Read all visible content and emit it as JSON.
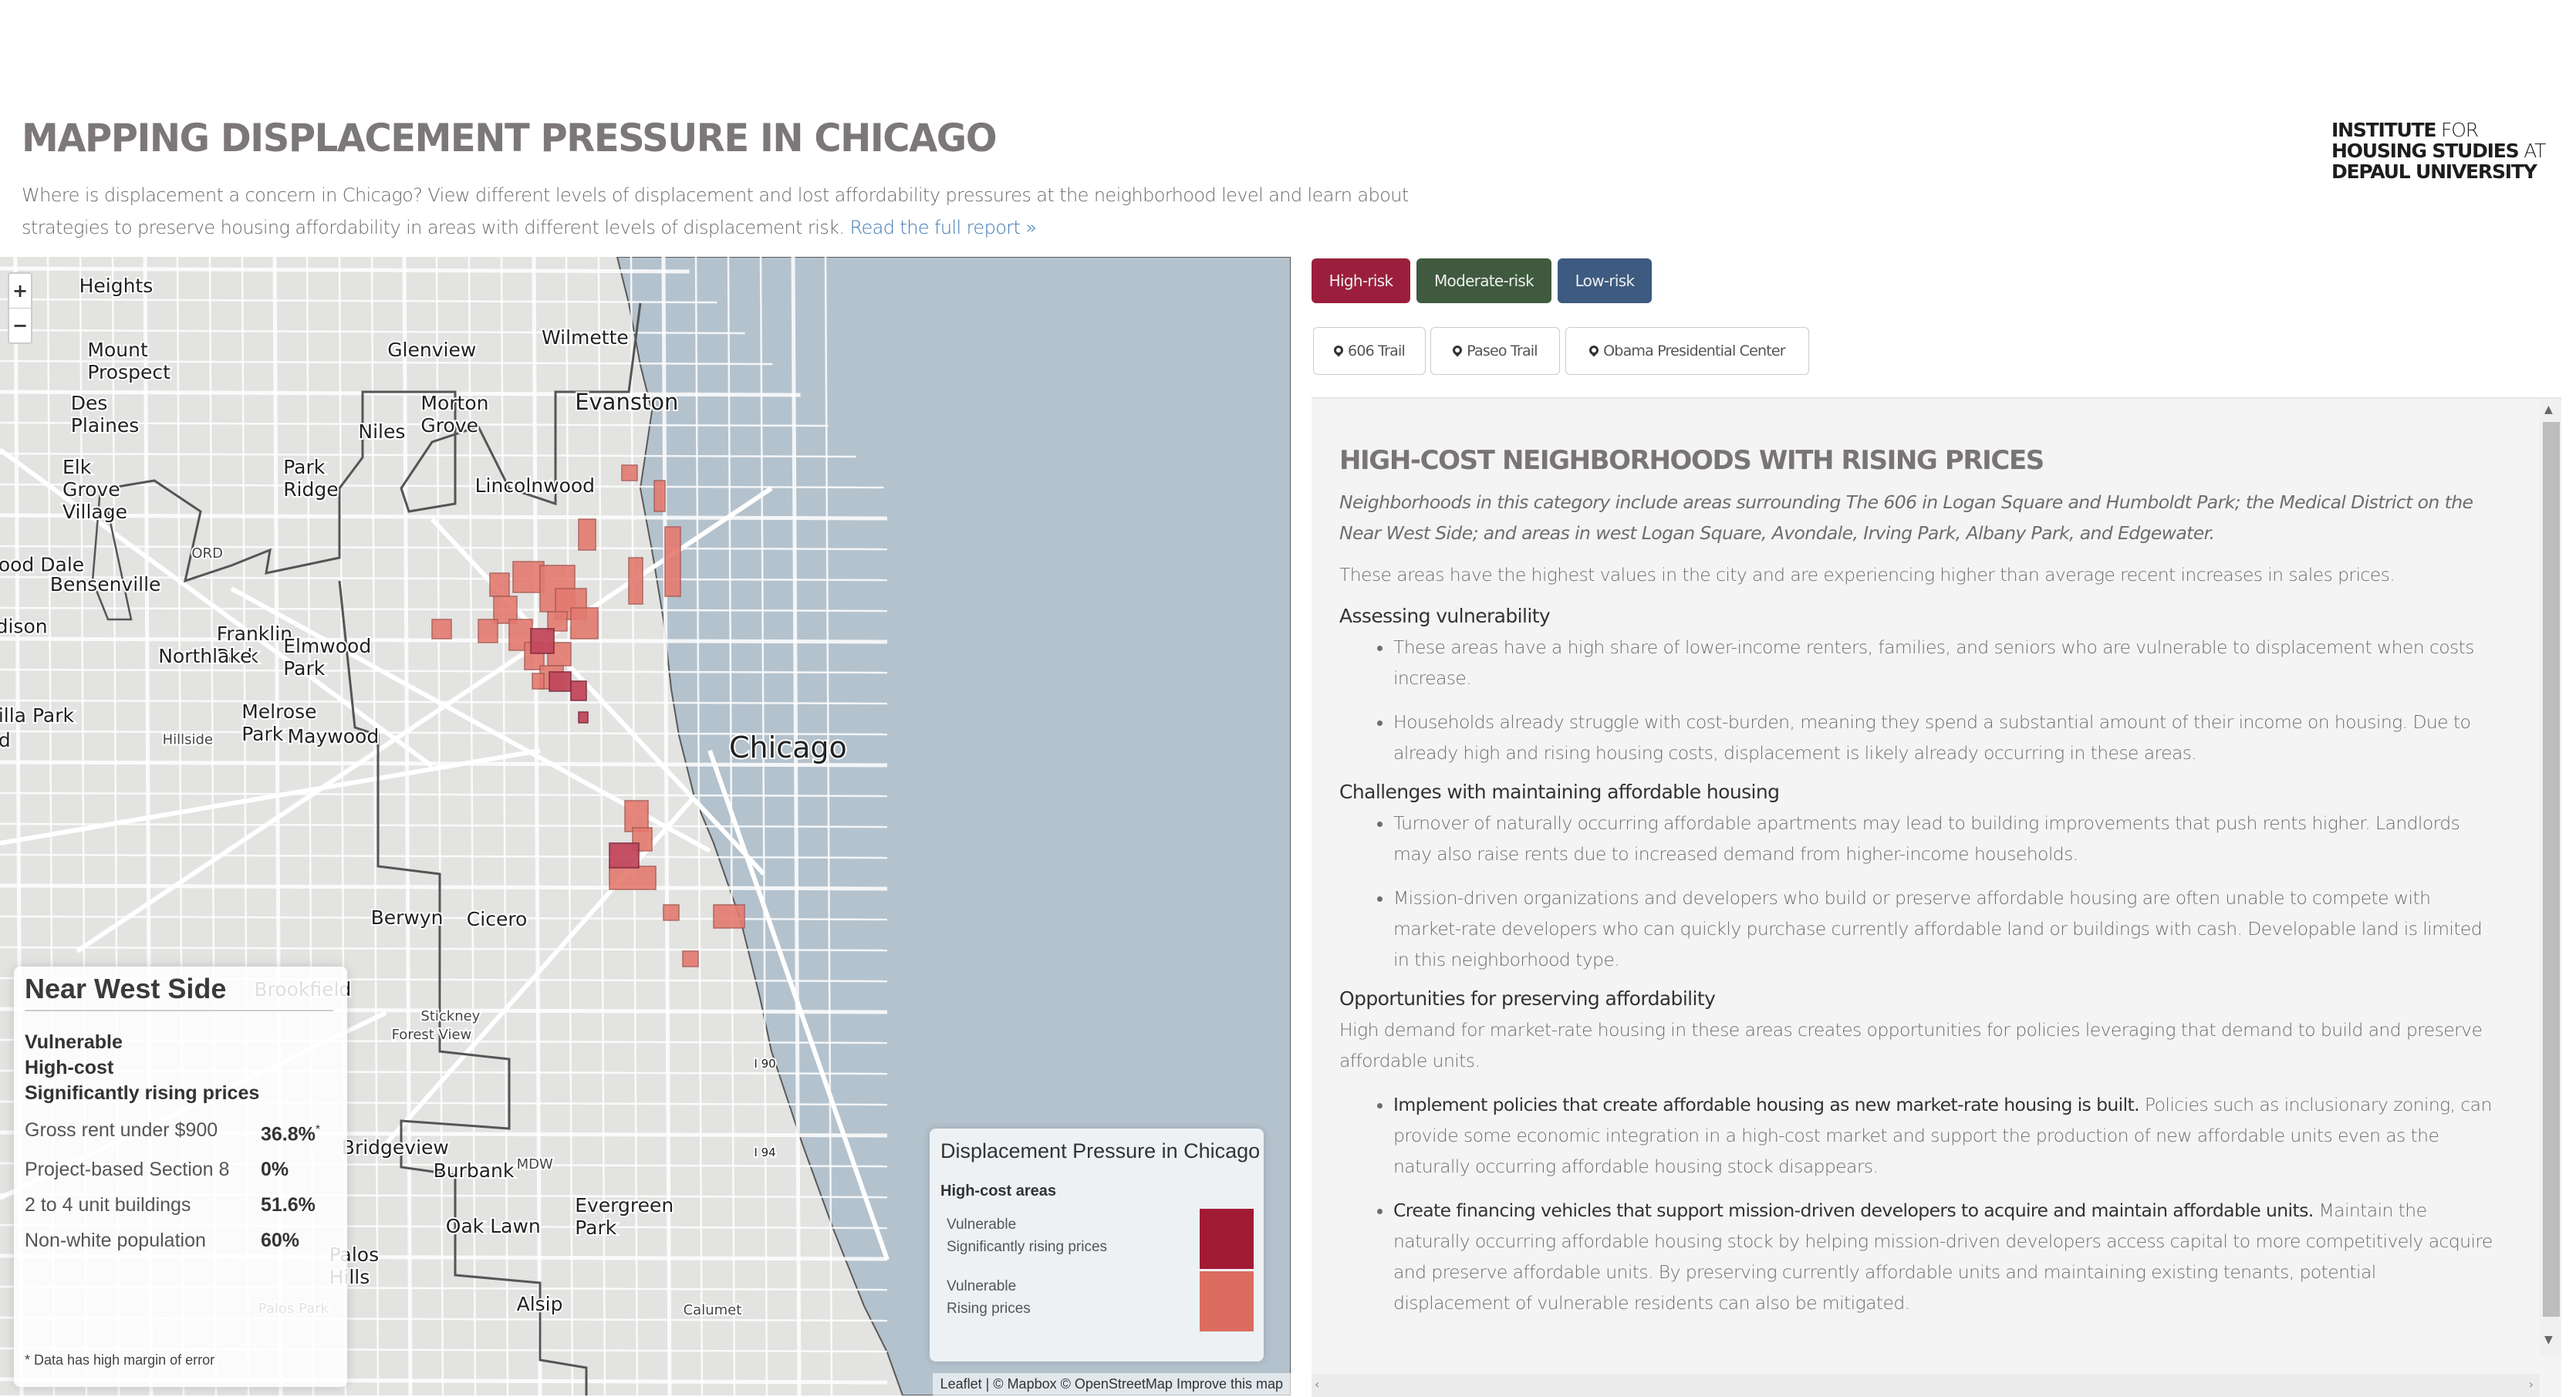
{
  "header": {
    "title": "MAPPING DISPLACEMENT PRESSURE IN CHICAGO",
    "intro": "Where is displacement a concern in Chicago? View different levels of displacement and lost affordability pressures at the neighborhood level and learn about strategies to preserve housing affordability in areas with different levels of displacement risk.",
    "report_link": "Read the full report »",
    "logo": {
      "line1_bold": "INSTITUTE",
      "line1_light": "FOR",
      "line2_bold": "HOUSING STUDIES",
      "line2_light": "AT",
      "line3_bold": "DEPAUL UNIVERSITY"
    }
  },
  "map": {
    "zoom_in": "+",
    "zoom_out": "−",
    "labels": [
      {
        "text": "Heights",
        "size": "m"
      },
      {
        "text": "Mount Prospect",
        "size": "m"
      },
      {
        "text": "Glenview",
        "size": "m"
      },
      {
        "text": "Wilmette",
        "size": "m"
      },
      {
        "text": "Des Plaines",
        "size": "m"
      },
      {
        "text": "Morton Grove",
        "size": "m"
      },
      {
        "text": "Evanston",
        "size": "l"
      },
      {
        "text": "Niles",
        "size": "m"
      },
      {
        "text": "Elk Grove Village",
        "size": "m"
      },
      {
        "text": "Park Ridge",
        "size": "m"
      },
      {
        "text": "Lincolnwood",
        "size": "m"
      },
      {
        "text": "ORD",
        "size": "s"
      },
      {
        "text": "ood Dale",
        "size": "m"
      },
      {
        "text": "Bensenville",
        "size": "m"
      },
      {
        "text": "Franklin Park",
        "size": "m"
      },
      {
        "text": "dison",
        "size": "m"
      },
      {
        "text": "Northlake",
        "size": "m"
      },
      {
        "text": "Elmwood Park",
        "size": "m"
      },
      {
        "text": "Melrose Park",
        "size": "m"
      },
      {
        "text": "illa Park",
        "size": "m"
      },
      {
        "text": "d",
        "size": "m"
      },
      {
        "text": "Hillside",
        "size": "s"
      },
      {
        "text": "Maywood",
        "size": "m"
      },
      {
        "text": "Chicago",
        "size": "xl"
      },
      {
        "text": "Berwyn",
        "size": "m"
      },
      {
        "text": "Cicero",
        "size": "m"
      },
      {
        "text": "Brookfield",
        "size": "m"
      },
      {
        "text": "Stickney",
        "size": "s"
      },
      {
        "text": "Forest View",
        "size": "s"
      },
      {
        "text": "I 90",
        "size": "shield"
      },
      {
        "text": "I 94",
        "size": "shield"
      },
      {
        "text": "MDW",
        "size": "s"
      },
      {
        "text": "Bridgeview",
        "size": "m"
      },
      {
        "text": "Burbank",
        "size": "m"
      },
      {
        "text": "Evergreen Park",
        "size": "m"
      },
      {
        "text": "Oak Lawn",
        "size": "m"
      },
      {
        "text": "Palos Hills",
        "size": "m"
      },
      {
        "text": "Alsip",
        "size": "m"
      },
      {
        "text": "Calumet",
        "size": "s"
      },
      {
        "text": "Palos Park",
        "size": "s"
      }
    ],
    "info": {
      "title": "Near West Side",
      "tags": [
        "Vulnerable",
        "High-cost",
        "Significantly rising prices"
      ],
      "rows": [
        {
          "label": "Gross rent under $900",
          "value": "36.8%",
          "note": "*"
        },
        {
          "label": "Project-based Section 8",
          "value": "0%",
          "note": ""
        },
        {
          "label": "2 to 4 unit buildings",
          "value": "51.6%",
          "note": ""
        },
        {
          "label": "Non-white population",
          "value": "60%",
          "note": ""
        }
      ],
      "footnote": "* Data has high margin of error"
    },
    "legend": {
      "title": "Displacement Pressure in Chicago",
      "subtitle": "High-cost areas",
      "items": [
        {
          "line1": "Vulnerable",
          "line2": "Significantly rising prices",
          "color": "#a21b35"
        },
        {
          "line1": "Vulnerable",
          "line2": "Rising prices",
          "color": "#dd6c60"
        }
      ]
    },
    "attribution": "Leaflet | © Mapbox © OpenStreetMap Improve this map",
    "colors": {
      "land": "#e3e3e1",
      "water": "#b4c2cd",
      "road": "#ffffff",
      "boundary": "#555555",
      "tract_high": "#c3485c",
      "tract_rising": "#e47a6f"
    }
  },
  "controls": {
    "risk_buttons": [
      {
        "label": "High-risk",
        "color": "#9b1f3d"
      },
      {
        "label": "Moderate-risk",
        "color": "#3f5a3e"
      },
      {
        "label": "Low-risk",
        "color": "#3d5a80"
      }
    ],
    "place_buttons": [
      {
        "label": "606 Trail",
        "icon": "map-marker-icon"
      },
      {
        "label": "Paseo Trail",
        "icon": "map-marker-icon"
      },
      {
        "label": "Obama Presidential Center",
        "icon": "map-marker-icon"
      }
    ]
  },
  "content": {
    "heading": "HIGH-COST NEIGHBORHOODS WITH RISING PRICES",
    "lead": "Neighborhoods in this category include areas surrounding The 606 in Logan Square and Humboldt Park; the Medical District on the Near West Side; and areas in west Logan Square, Avondale, Irving Park, Albany Park, and Edgewater.",
    "summary": "These areas have the highest values in the city and are experiencing higher than average recent increases in sales prices.",
    "sections": [
      {
        "title": "Assessing vulnerability",
        "intro": "",
        "bullets": [
          {
            "bold": "",
            "text": "These areas have a high share of lower-income renters, families, and seniors who are vulnerable to displacement when costs increase."
          },
          {
            "bold": "",
            "text": "Households already struggle with cost-burden, meaning they spend a substantial amount of their income on housing. Due to already high and rising housing costs, displacement is likely already occurring in these areas."
          }
        ]
      },
      {
        "title": "Challenges with maintaining affordable housing",
        "intro": "",
        "bullets": [
          {
            "bold": "",
            "text": "Turnover of naturally occurring affordable apartments may lead to building improvements that push rents higher. Landlords may also raise rents due to increased demand from higher-income households."
          },
          {
            "bold": "",
            "text": "Mission-driven organizations and developers who build or preserve affordable housing are often unable to compete with market-rate developers who can quickly purchase currently affordable land or buildings with cash. Developable land is limited in this neighborhood type."
          }
        ]
      },
      {
        "title": "Opportunities for preserving affordability",
        "intro": "High demand for market-rate housing in these areas creates opportunities for policies leveraging that demand to build and preserve affordable units.",
        "bullets": [
          {
            "bold": "Implement policies that create affordable housing as new market-rate housing is built.",
            "text": " Policies such as inclusionary zoning, can provide some economic integration in a high-cost market and support the production of new affordable units even as the naturally occurring affordable housing stock disappears."
          },
          {
            "bold": "Create financing vehicles that support mission-driven developers to acquire and maintain affordable units.",
            "text": " Maintain the naturally occurring affordable housing stock by helping mission-driven developers access capital to more competitively acquire and preserve affordable units. By preserving currently affordable units and maintaining existing tenants, potential displacement of vulnerable residents can also be mitigated."
          }
        ]
      }
    ]
  }
}
